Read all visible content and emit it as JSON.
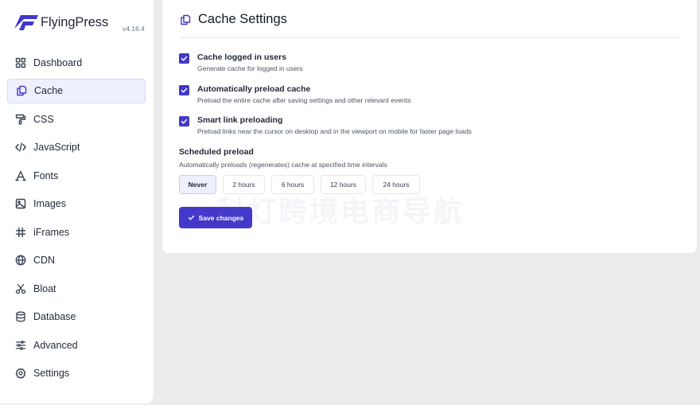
{
  "brand": {
    "name": "FlyingPress",
    "version": "v4.16.4"
  },
  "sidebar": {
    "items": [
      {
        "label": "Dashboard",
        "icon": "grid-icon"
      },
      {
        "label": "Cache",
        "icon": "copy-icon",
        "active": true
      },
      {
        "label": "CSS",
        "icon": "paint-roller-icon"
      },
      {
        "label": "JavaScript",
        "icon": "code-icon"
      },
      {
        "label": "Fonts",
        "icon": "font-icon"
      },
      {
        "label": "Images",
        "icon": "image-icon"
      },
      {
        "label": "iFrames",
        "icon": "hash-icon"
      },
      {
        "label": "CDN",
        "icon": "globe-icon"
      },
      {
        "label": "Bloat",
        "icon": "scissors-icon"
      },
      {
        "label": "Database",
        "icon": "database-icon"
      },
      {
        "label": "Advanced",
        "icon": "sliders-icon"
      },
      {
        "label": "Settings",
        "icon": "gear-icon"
      }
    ]
  },
  "main": {
    "title": "Cache Settings",
    "options": [
      {
        "label": "Cache logged in users",
        "description": "Generate cache for logged in users",
        "checked": true
      },
      {
        "label": "Automatically preload cache",
        "description": "Preload the entire cache after saving settings and other relevant events",
        "checked": true
      },
      {
        "label": "Smart link preloading",
        "description": "Preload links near the cursor on desktop and in the viewport on mobile for faster page loads",
        "checked": true
      }
    ],
    "scheduled_preload": {
      "title": "Scheduled preload",
      "description": "Automatically preloads (regenerates) cache at specified time intervals",
      "intervals": [
        "Never",
        "2 hours",
        "6 hours",
        "12 hours",
        "24 hours"
      ],
      "selected": "Never"
    },
    "save_label": "Save changes"
  },
  "watermark": "科灯跨境电商导航",
  "colors": {
    "accent": "#4338ca",
    "active_bg": "#eef0fd",
    "background": "#ececed"
  }
}
